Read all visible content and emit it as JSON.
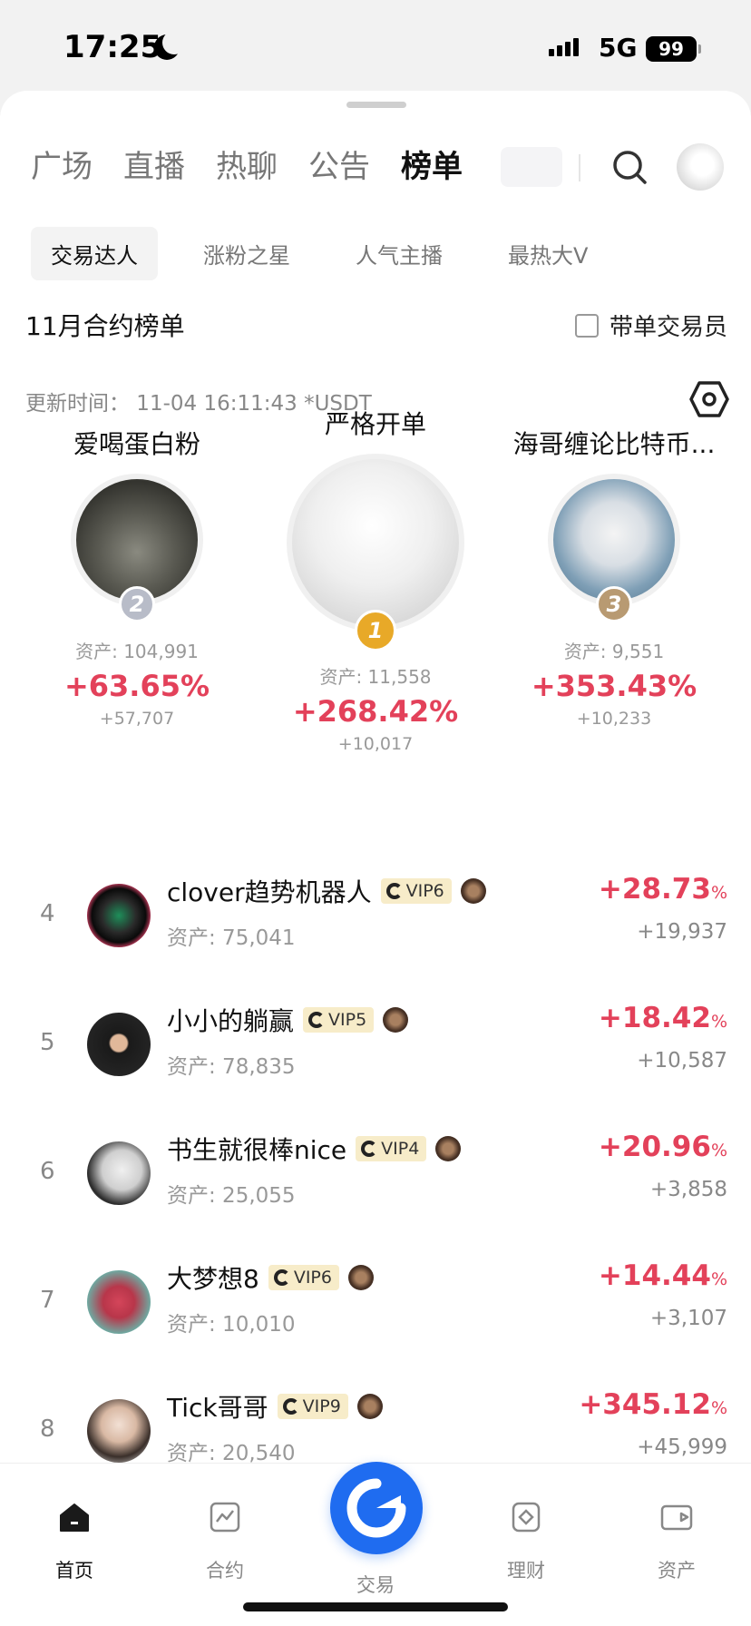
{
  "status_bar": {
    "time": "17:25",
    "network": "5G",
    "battery": "99"
  },
  "top_tabs": [
    {
      "label": "广场",
      "active": false
    },
    {
      "label": "直播",
      "active": false
    },
    {
      "label": "热聊",
      "active": false
    },
    {
      "label": "公告",
      "active": false
    },
    {
      "label": "榜单",
      "active": true
    }
  ],
  "sub_tabs": [
    {
      "label": "交易达人",
      "active": true
    },
    {
      "label": "涨粉之星",
      "active": false
    },
    {
      "label": "人气主播",
      "active": false
    },
    {
      "label": "最热大V",
      "active": false
    }
  ],
  "section_title": "11月合约榜单",
  "filter_checkbox": {
    "label": "带单交易员",
    "checked": false
  },
  "update_time": "更新时间： 11-04 16:11:43  *USDT",
  "podium": [
    {
      "rank": "2",
      "name": "爱喝蛋白粉",
      "assets": "资产: 104,991",
      "pct": "+63.65%",
      "abs": "+57,707"
    },
    {
      "rank": "1",
      "name": "严格开单",
      "assets": "资产: 11,558",
      "pct": "+268.42%",
      "abs": "+10,017"
    },
    {
      "rank": "3",
      "name": "海哥缠论比特币...",
      "assets": "资产: 9,551",
      "pct": "+353.43%",
      "abs": "+10,233"
    }
  ],
  "list": [
    {
      "rank": "4",
      "name": "clover趋势机器人",
      "vip": "VIP6",
      "assets": "资产: 75,041",
      "pct": "+28.73",
      "pct_unit": "%",
      "abs": "+19,937"
    },
    {
      "rank": "5",
      "name": "小小的躺赢",
      "vip": "VIP5",
      "assets": "资产: 78,835",
      "pct": "+18.42",
      "pct_unit": "%",
      "abs": "+10,587"
    },
    {
      "rank": "6",
      "name": "书生就很棒nice",
      "vip": "VIP4",
      "assets": "资产: 25,055",
      "pct": "+20.96",
      "pct_unit": "%",
      "abs": "+3,858"
    },
    {
      "rank": "7",
      "name": "大梦想8",
      "vip": "VIP6",
      "assets": "资产: 10,010",
      "pct": "+14.44",
      "pct_unit": "%",
      "abs": "+3,107"
    },
    {
      "rank": "8",
      "name": "Tick哥哥",
      "vip": "VIP9",
      "assets": "资产: 20,540",
      "pct": "+345.12",
      "pct_unit": "%",
      "abs": "+45,999"
    }
  ],
  "bottom_nav": [
    {
      "label": "首页",
      "icon": "home-icon",
      "active": true
    },
    {
      "label": "合约",
      "icon": "chart-icon",
      "active": false
    },
    {
      "label": "交易",
      "icon": "trade-icon",
      "active": false
    },
    {
      "label": "理财",
      "icon": "wealth-icon",
      "active": false
    },
    {
      "label": "资产",
      "icon": "wallet-icon",
      "active": false
    }
  ],
  "colors": {
    "positive": "#e3415a",
    "accent": "#1f6cf0",
    "vip_bg": "#f7ecc9",
    "gold": "#e8a928",
    "silver": "#b8bcc8",
    "bronze": "#b89a72"
  }
}
